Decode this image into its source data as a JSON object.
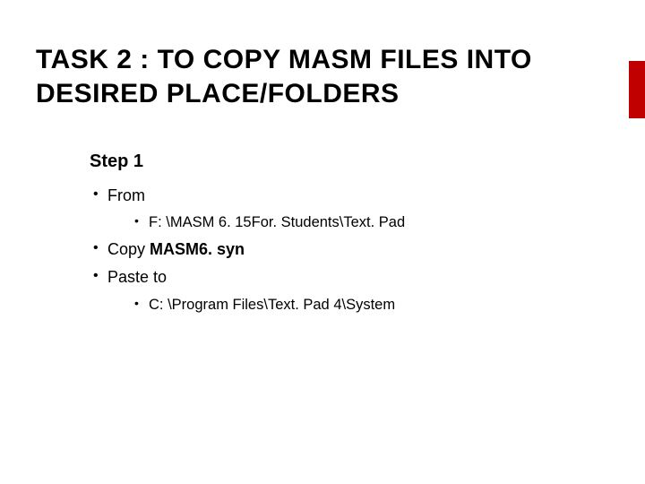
{
  "title": "TASK 2 : TO COPY MASM FILES INTO DESIRED PLACE/FOLDERS",
  "step_heading": "Step 1",
  "bullets": {
    "from_label": "From",
    "from_path": "F: \\MASM 6. 15For. Students\\Text. Pad",
    "copy_prefix": "Copy ",
    "copy_bold": "MASM6. syn",
    "paste_label": "Paste to",
    "paste_path": "C: \\Program Files\\Text. Pad 4\\System"
  }
}
